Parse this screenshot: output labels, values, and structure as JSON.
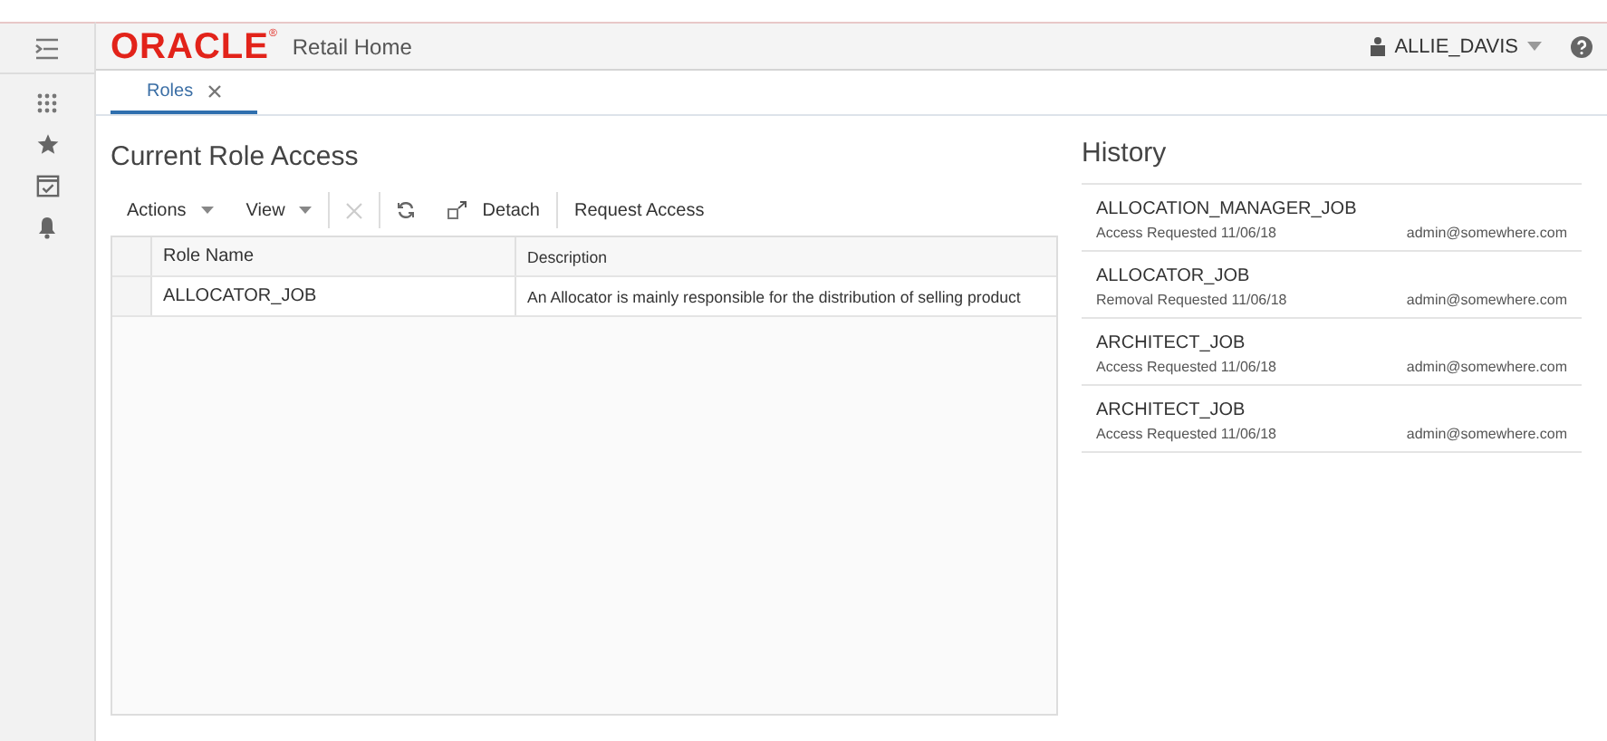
{
  "header": {
    "logo": "ORACLE",
    "logo_mark": "®",
    "app_title": "Retail Home",
    "user": "ALLIE_DAVIS"
  },
  "tabs": [
    {
      "label": "Roles",
      "selected": true
    }
  ],
  "current": {
    "title": "Current Role Access",
    "toolbar": [
      {
        "kind": "menu",
        "label": "Actions"
      },
      {
        "kind": "menu",
        "label": "View"
      },
      {
        "kind": "separator"
      },
      {
        "kind": "delete",
        "disabled": true
      },
      {
        "kind": "separator"
      },
      {
        "kind": "refresh"
      },
      {
        "kind": "detach",
        "label": "Detach"
      },
      {
        "kind": "separator"
      },
      {
        "kind": "button",
        "label": "Request Access"
      }
    ],
    "table": {
      "columns": [
        "Role Name",
        "Description"
      ],
      "rows": [
        {
          "cells": [
            "ALLOCATOR_JOB",
            "An Allocator is mainly responsible for the distribution of selling product"
          ]
        }
      ]
    }
  },
  "history": {
    "title": "History",
    "items": [
      {
        "role": "ALLOCATION_MANAGER_JOB",
        "action": "Access Requested 11/06/18",
        "user": "admin@somewhere.com"
      },
      {
        "role": "ALLOCATOR_JOB",
        "action": "Removal Requested 11/06/18",
        "user": "admin@somewhere.com"
      },
      {
        "role": "ARCHITECT_JOB",
        "action": "Access Requested 11/06/18",
        "user": "admin@somewhere.com"
      },
      {
        "role": "ARCHITECT_JOB",
        "action": "Access Requested 11/06/18",
        "user": "admin@somewhere.com"
      }
    ]
  }
}
